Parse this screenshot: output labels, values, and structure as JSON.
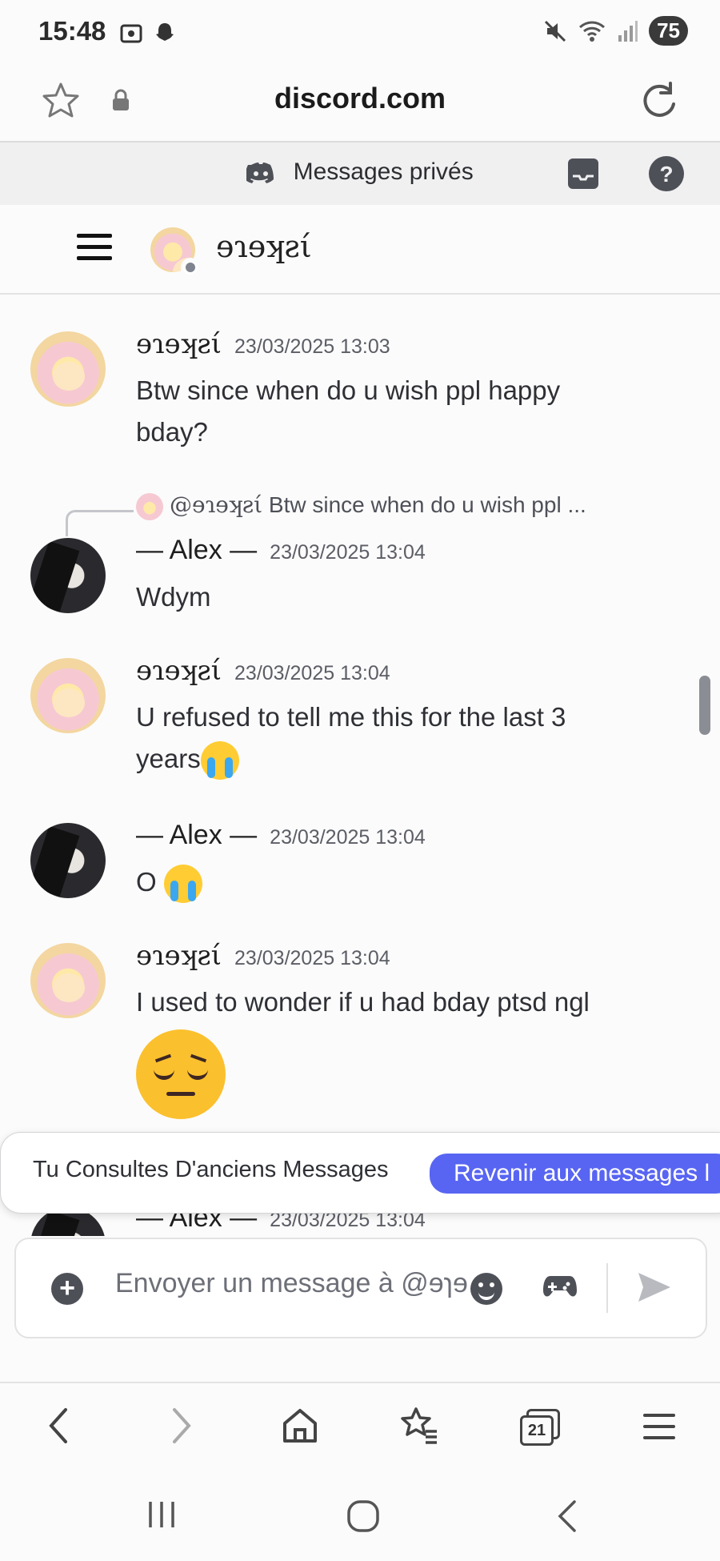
{
  "status_bar": {
    "time": "15:48",
    "battery": "75",
    "icons": [
      "screenshot-icon",
      "snapchat-icon",
      "mute-icon",
      "wifi-icon",
      "signal-icon"
    ]
  },
  "browser": {
    "url": "discord.com",
    "tabs_count": "21"
  },
  "discord": {
    "top_title": "Messages privés",
    "dm_name": "ɘɿɘʞƨί",
    "messages": [
      {
        "author": "ɘɿɘʞƨί",
        "timestamp": "23/03/2025 13:03",
        "text": "Btw since when do u wish ppl happy bday?"
      },
      {
        "author": "— Alex —",
        "timestamp": "23/03/2025 13:04",
        "text": "Wdym",
        "reply": {
          "mention": "@ɘɿɘʞƨί",
          "text": "Btw since when do u wish ppl ..."
        }
      },
      {
        "author": "ɘɿɘʞƨί",
        "timestamp": "23/03/2025 13:04",
        "text": "U refused to tell me this for the last 3 years"
      },
      {
        "author": "— Alex —",
        "timestamp": "23/03/2025 13:04",
        "text": "O"
      },
      {
        "author": "ɘɿɘʞƨί",
        "timestamp": "23/03/2025 13:04",
        "text": "I used to wonder if u had bday ptsd ngl"
      },
      {
        "author": "— Alex —",
        "timestamp": "23/03/2025 13:04",
        "text": ""
      }
    ],
    "jump_banner": {
      "text": "Tu Consultes D'anciens Messages",
      "button": "Revenir aux messages l"
    },
    "composer": {
      "placeholder": "Envoyer un message à @ɘɿɘʞƨί"
    }
  },
  "colors": {
    "blurple": "#5865f2",
    "scroll": "#8b8d94"
  }
}
